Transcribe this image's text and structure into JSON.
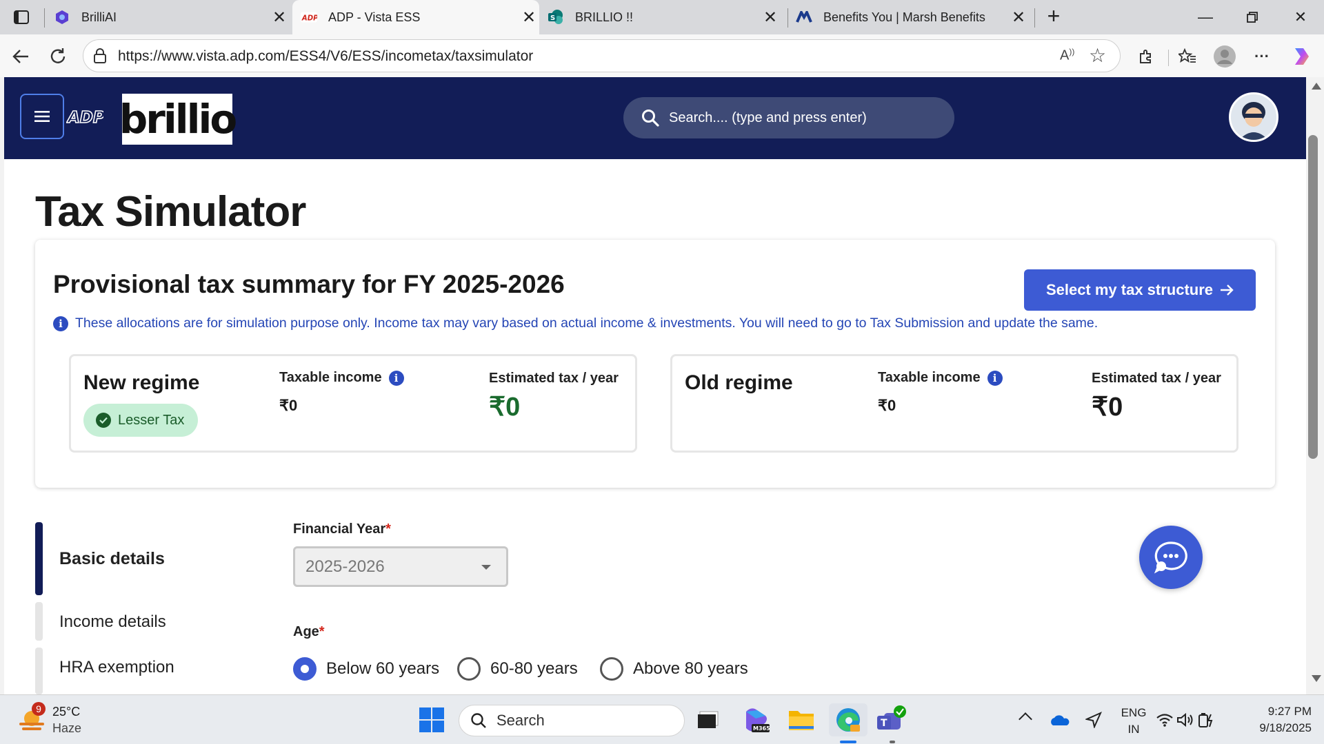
{
  "browser": {
    "tabs": [
      {
        "title": "BrilliAI",
        "icon": "brilliai-favicon",
        "active": false
      },
      {
        "title": "ADP - Vista ESS",
        "icon": "adp-favicon",
        "active": true
      },
      {
        "title": "BRILLIO !!",
        "icon": "sharepoint-favicon",
        "active": false
      },
      {
        "title": "Benefits You | Marsh Benefits",
        "icon": "marsh-favicon",
        "active": false
      }
    ],
    "url": "https://www.vista.adp.com/ESS4/V6/ESS/incometax/taxsimulator"
  },
  "header": {
    "logo_adp": "ADP",
    "logo_brand": "brillio",
    "search_placeholder": "Search.... (type and press enter)"
  },
  "page": {
    "title": "Tax Simulator",
    "summary": {
      "title": "Provisional tax summary for FY 2025-2026",
      "select_button": "Select my tax structure",
      "info_text": "These allocations are for simulation purpose only. Income tax may vary based on actual income & investments. You will need to go to Tax Submission and update the same.",
      "new_regime": {
        "name": "New regime",
        "badge": "Lesser Tax",
        "taxable_label": "Taxable income",
        "taxable_value": "₹0",
        "estimated_label": "Estimated tax / year",
        "estimated_value": "₹0"
      },
      "old_regime": {
        "name": "Old regime",
        "taxable_label": "Taxable income",
        "taxable_value": "₹0",
        "estimated_label": "Estimated tax / year",
        "estimated_value": "₹0"
      }
    },
    "steps": [
      {
        "label": "Basic details",
        "active": true
      },
      {
        "label": "Income details",
        "active": false
      },
      {
        "label": "HRA exemption",
        "active": false
      }
    ],
    "form": {
      "fy_label": "Financial Year",
      "fy_value": "2025-2026",
      "age_label": "Age",
      "required_mark": "*",
      "age_options": [
        "Below 60 years",
        "60-80 years",
        "Above 80 years"
      ],
      "age_selected": "Below 60 years"
    }
  },
  "taskbar": {
    "weather_temp": "25°C",
    "weather_desc": "Haze",
    "weather_badge": "9",
    "search_placeholder": "Search",
    "lang": "ENG",
    "region": "IN",
    "time": "9:27 PM",
    "date": "9/18/2025",
    "m365_label": "M365"
  },
  "colors": {
    "header_bg": "#121d57",
    "accent": "#3d5bd4",
    "info_text": "#2445b5",
    "green": "#1a5c2a",
    "badge_bg": "#c6efd6"
  }
}
